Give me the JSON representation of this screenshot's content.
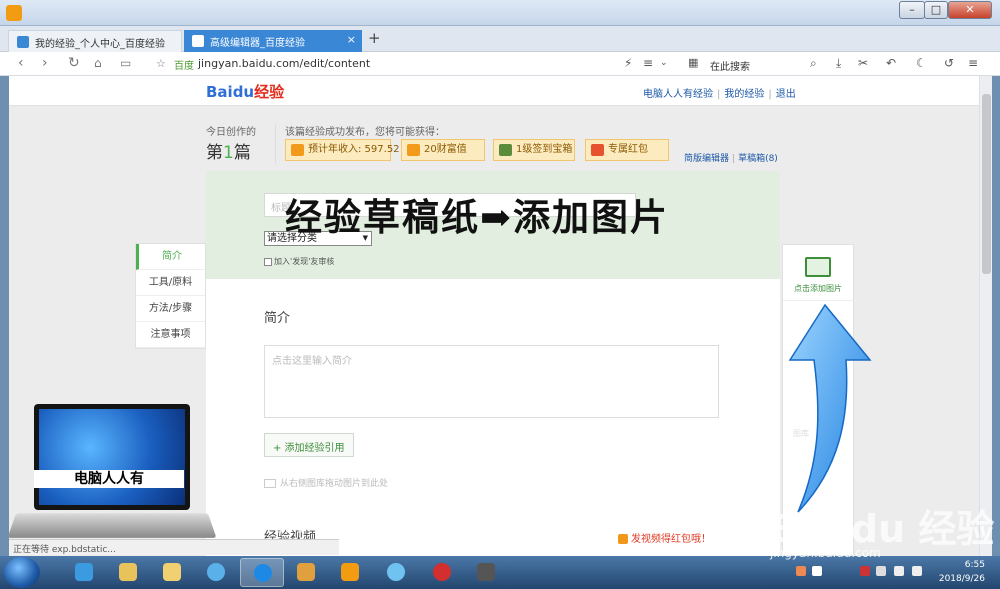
{
  "browser": {
    "tabs": [
      {
        "label": "我的经验_个人中心_百度经验",
        "active": false
      },
      {
        "label": "高级编辑器_百度经验",
        "active": true
      }
    ],
    "tab_count": "2",
    "url": "jingyan.baidu.com/edit/content",
    "site_tag": "百度",
    "search_placeholder": "在此搜索",
    "status_text": "正在等待 exp.bdstatic...",
    "window_controls": [
      "–",
      "□",
      "✕"
    ]
  },
  "site": {
    "logo_text": "Baidu",
    "logo_jy": "经验",
    "top_links": [
      "电脑人人有经验",
      "我的经验",
      "退出"
    ],
    "today_label": "今日创作的",
    "count_pre": "第",
    "count_num": "1",
    "count_post": "篇",
    "earn_title": "该篇经验成功发布，您将可能获得：",
    "rewards": [
      "预计年收入: 597.52",
      "20财富值",
      "1级签到宝箱",
      "专属红包"
    ],
    "editor_links": [
      "简版编辑器",
      "草稿箱(8)"
    ]
  },
  "editor": {
    "title_placeholder": "标题",
    "category_select": "请选择分类",
    "checkbox_label": "加入'发现'友审核",
    "intro_heading": "简介",
    "intro_placeholder": "点击这里输入简介",
    "add_quote": "+ 添加经验引用",
    "drag_hint": "从右侧图库拖动图片到此处",
    "video_heading": "经验视频",
    "video_reward": "发视频得红包哦！"
  },
  "sidenav": [
    "简介",
    "工具/原料",
    "方法/步骤",
    "注意事项"
  ],
  "rightpanel": {
    "add_image": "点击添加图片",
    "faint": "图库"
  },
  "overlay": {
    "title": "经验草稿纸➡添加图片",
    "laptop_label": "电脑人人有",
    "ghost": "草稿箱"
  },
  "watermark": {
    "brand": "Bai du 经验",
    "url": "jingyan.baidu.com"
  },
  "taskbar": {
    "time": "6:55",
    "date": "2018/9/26"
  },
  "colors": {
    "accent": "#3a87d6",
    "green": "#4caf50",
    "reward_bg": "#fdebc0",
    "arrow": "#3aa0f0"
  }
}
